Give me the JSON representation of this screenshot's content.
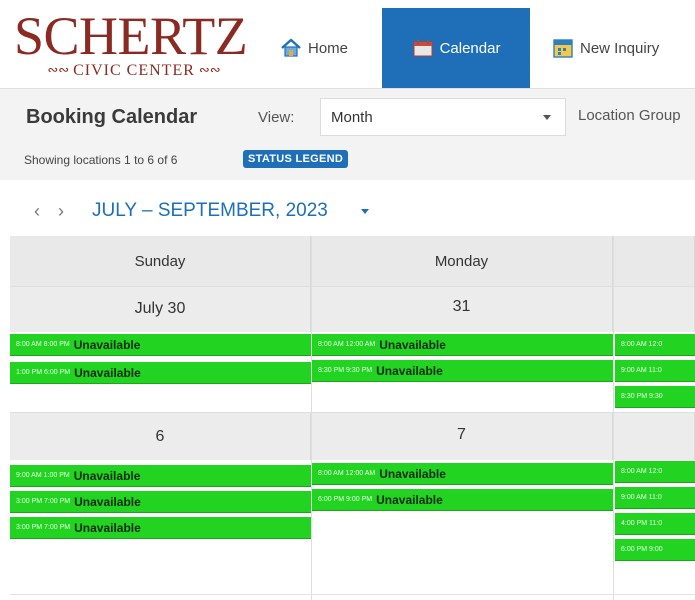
{
  "logo": {
    "title": "SCHERTZ",
    "subtitle": "CIVIC CENTER"
  },
  "nav": {
    "home": "Home",
    "calendar": "Calendar",
    "inquiry": "New Inquiry"
  },
  "toolbar": {
    "title": "Booking Calendar",
    "view_label": "View:",
    "view_value": "Month",
    "location_label": "Location Group",
    "showing": "Showing locations 1 to 6 of 6",
    "legend": "STATUS LEGEND"
  },
  "range": {
    "title": "JULY – SEPTEMBER, 2023"
  },
  "calendar": {
    "days": [
      "Sunday",
      "Monday"
    ],
    "week1": {
      "dates": [
        "July 30",
        "31"
      ],
      "sun": [
        {
          "time": "8:00 AM  8:00 PM",
          "status": "Unavailable"
        },
        {
          "time": "1:00 PM  6:00 PM",
          "status": "Unavailable"
        }
      ],
      "mon": [
        {
          "time": "8:00 AM  12:00 AM",
          "status": "Unavailable"
        },
        {
          "time": "8:30 PM  9:30 PM",
          "status": "Unavailable"
        }
      ],
      "tue": [
        {
          "time": "8:00 AM  12:0"
        },
        {
          "time": "9:00 AM  11:0"
        },
        {
          "time": "8:30 PM  9:30"
        }
      ]
    },
    "week2": {
      "dates": [
        "6",
        "7"
      ],
      "sun": [
        {
          "time": "9:00 AM  1:00 PM",
          "status": "Unavailable"
        },
        {
          "time": "3:00 PM  7:00 PM",
          "status": "Unavailable"
        },
        {
          "time": "3:00 PM  7:00 PM",
          "status": "Unavailable"
        }
      ],
      "mon": [
        {
          "time": "8:00 AM  12:00 AM",
          "status": "Unavailable"
        },
        {
          "time": "6:00 PM  9:00 PM",
          "status": "Unavailable"
        }
      ],
      "tue": [
        {
          "time": "8:00 AM  12:0"
        },
        {
          "time": "9:00 AM  11:0"
        },
        {
          "time": "4:00 PM  11:0"
        },
        {
          "time": "6:00 PM  9:00"
        }
      ]
    }
  },
  "colors": {
    "accent": "#1e6fb8",
    "event": "#22d322",
    "brand": "#8a2a22"
  }
}
